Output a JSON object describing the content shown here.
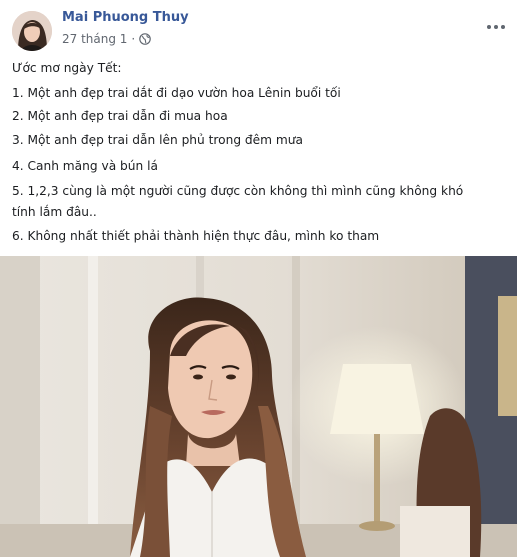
{
  "post": {
    "author": "Mai Phuong Thuy",
    "date": "27 tháng 1",
    "separator": "·",
    "privacy_icon": "globe-icon",
    "more_icon": "more-horizontal-icon",
    "avatar_icon": "profile-avatar",
    "lines": [
      "Ước mơ ngày Tết:",
      "1. Một anh đẹp trai dắt đi dạo vườn hoa Lênin buổi tối",
      "2. Một anh đẹp trai dẫn đi mua hoa",
      "3. Một anh đẹp trai dẫn lên phủ trong đêm mưa",
      "4. Canh măng và bún lá",
      "5. 1,2,3 cùng là một người cũng được còn không thì mình cũng không khó",
      "tính lắm đâu..",
      "6. Không nhất thiết phải thành hiện thực đâu, mình ko tham"
    ]
  },
  "colors": {
    "author": "#385898",
    "meta": "#616770",
    "text": "#1c1e21"
  }
}
